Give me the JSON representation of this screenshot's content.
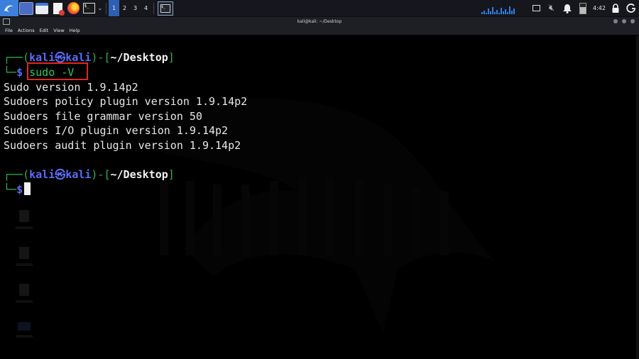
{
  "taskbar": {
    "workspaces": [
      "1",
      "2",
      "3",
      "4"
    ],
    "clock": "4:42"
  },
  "window": {
    "title": "kali@kali: ~/Desktop",
    "menu": [
      "File",
      "Actions",
      "Edit",
      "View",
      "Help"
    ]
  },
  "terminal": {
    "prompt1": {
      "open": "┌──(",
      "user": "kali",
      "at": "㉿",
      "host": "kali",
      "mid": ")-[",
      "path": "~/Desktop",
      "close": "]"
    },
    "prompt1_line2": {
      "corner": "└─",
      "dollar": "$",
      "command": "sudo -V"
    },
    "output": [
      "Sudo version 1.9.14p2",
      "Sudoers policy plugin version 1.9.14p2",
      "Sudoers file grammar version 50",
      "Sudoers I/O plugin version 1.9.14p2",
      "Sudoers audit plugin version 1.9.14p2"
    ],
    "prompt2": {
      "open": "┌──(",
      "user": "kali",
      "at": "㉿",
      "host": "kali",
      "mid": ")-[",
      "path": "~/Desktop",
      "close": "]"
    },
    "prompt2_line2": {
      "corner": "└─",
      "dollar": "$"
    }
  },
  "colors": {
    "prompt_green": "#2fb34a",
    "prompt_blue": "#5b6cf7",
    "highlight_red": "#e3261f",
    "panel_bg": "#15171d"
  },
  "icons": [
    "kali-menu-icon",
    "workspace-switcher-icon",
    "file-manager-icon",
    "text-editor-icon",
    "firefox-icon",
    "terminal-icon",
    "screen-icon",
    "mute-icon",
    "notification-bell-icon",
    "battery-icon",
    "lock-icon",
    "logout-icon"
  ]
}
